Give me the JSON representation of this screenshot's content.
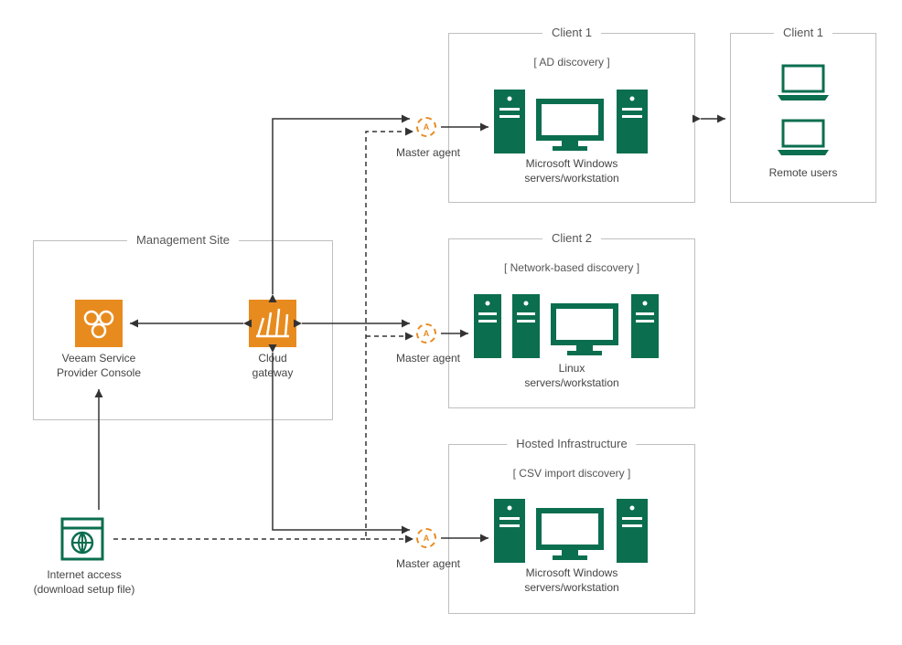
{
  "boxes": {
    "management": "Management Site",
    "client1_main": "Client 1",
    "client1_remote": "Client 1",
    "client2": "Client 2",
    "hosted": "Hosted Infrastructure"
  },
  "discovery": {
    "client1": "[ AD discovery ]",
    "client2": "[ Network-based discovery ]",
    "hosted": "[ CSV import discovery ]"
  },
  "labels": {
    "veeam": "Veeam Service\nProvider Console",
    "cloud": "Cloud\ngateway",
    "agent": "Master agent",
    "win": "Microsoft Windows\nservers/workstation",
    "linux": "Linux\nservers/workstation",
    "remote": "Remote users",
    "internet": "Internet  access\n(download setup file)"
  }
}
